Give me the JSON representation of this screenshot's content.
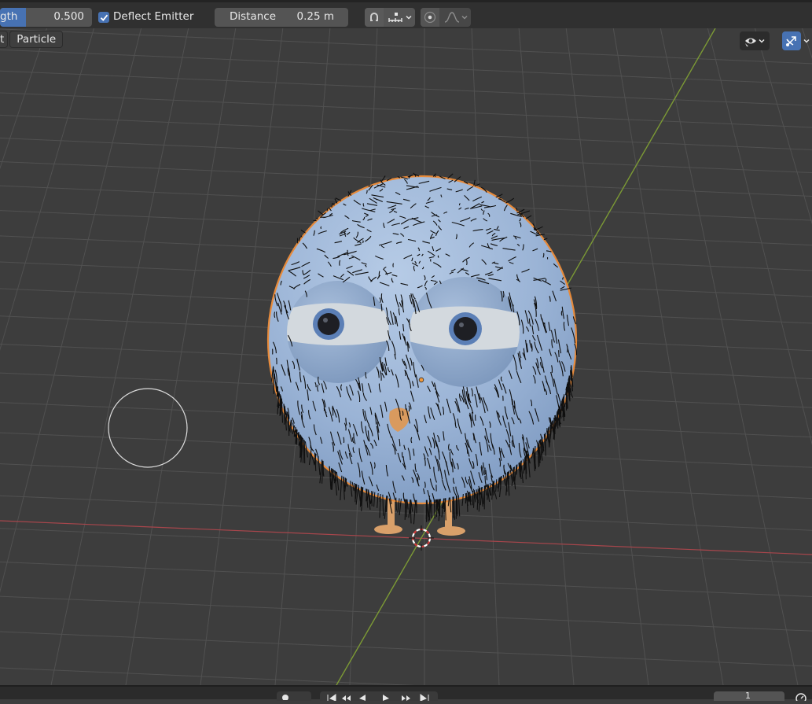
{
  "toolbar": {
    "length_label": "gth",
    "length_value": "0.500",
    "length_fraction": 0.28,
    "deflect_checked": true,
    "deflect_label": "Deflect Emitter",
    "distance_label": "Distance",
    "distance_value": "0.25 m"
  },
  "header": {
    "left_partial": "t",
    "particle_button": "Particle"
  },
  "footer": {
    "frame_value": "1"
  },
  "colors": {
    "accent": "#4772b3",
    "viewport_bg": "#3d3d3d",
    "grid": "#525252",
    "x_axis": "#a8464c",
    "y_axis": "#7c9a35",
    "body": "#9fb7d7",
    "outline": "#e78a3a"
  }
}
